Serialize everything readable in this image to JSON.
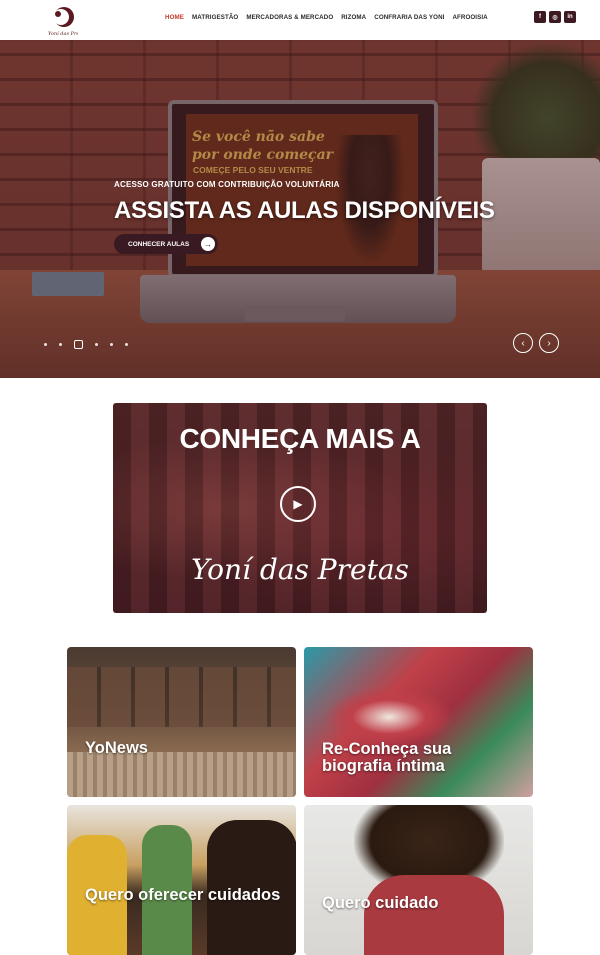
{
  "header": {
    "logo_text": "Yoni das Pretas",
    "nav": [
      {
        "label": "HOME",
        "active": true
      },
      {
        "label": "MATRIGESTÃO",
        "active": false
      },
      {
        "label": "MERCADORAS & MERCADO",
        "active": false
      },
      {
        "label": "RIZOMA",
        "active": false
      },
      {
        "label": "CONFRARIA DAS YONI",
        "active": false
      },
      {
        "label": "AFROOISIA",
        "active": false
      }
    ],
    "social": [
      {
        "icon": "facebook-icon",
        "glyph": "f"
      },
      {
        "icon": "instagram-icon",
        "glyph": "◎"
      },
      {
        "icon": "linkedin-icon",
        "glyph": "in"
      }
    ],
    "accent_color": "#c23a2a",
    "brand_color": "#3d1a22"
  },
  "hero": {
    "laptop_line1": "Se você não sabe",
    "laptop_line2": "por onde começar",
    "laptop_line3": "COMEÇE PELO SEU VENTRE",
    "subtitle": "ACESSO GRATUITO COM CONTRIBUIÇÃO VOLUNTÁRIA",
    "title": "ASSISTA AS AULAS DISPONÍVEIS",
    "button_label": "CONHECER AULAS",
    "slide_count": 6,
    "active_slide": 3
  },
  "video": {
    "title": "CONHEÇA MAIS A",
    "script_text": "Yoní das Pretas"
  },
  "cards": [
    {
      "title": "YoNews"
    },
    {
      "title": "Re-Conheça sua biografia íntima"
    },
    {
      "title": "Quero oferecer cuidados"
    },
    {
      "title": "Quero cuidado"
    }
  ]
}
